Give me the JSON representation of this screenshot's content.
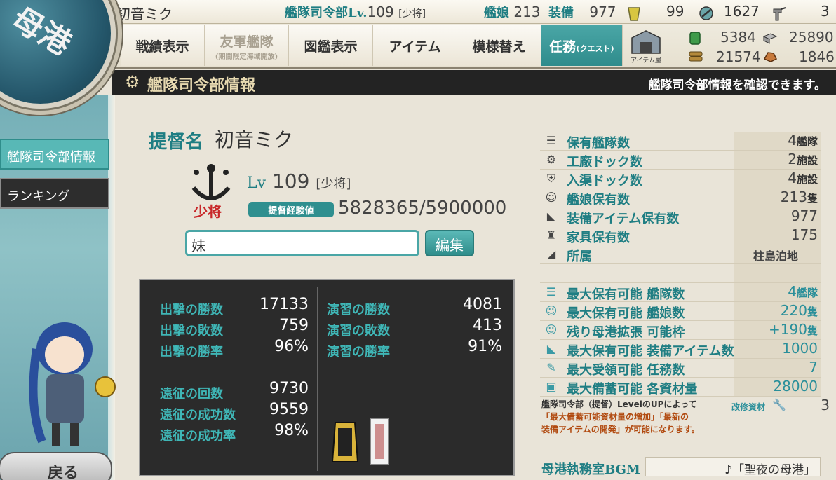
{
  "port": {
    "emblem_text": "母港"
  },
  "status": {
    "player_name": "初音ミク",
    "hq_label": "艦隊司令部Lv.",
    "hq_level": "109",
    "rank": "[少将]",
    "ships_label": "艦娘",
    "ships": "213",
    "equip_label": "装備",
    "equip": "977",
    "bucket": "99",
    "devmat": "1627",
    "screw": "3"
  },
  "menu": {
    "record": "戦績表示",
    "friend_fleet": "友軍艦隊",
    "friend_fleet_sub": "(期間限定海域開放)",
    "album": "図鑑表示",
    "item": "アイテム",
    "remodel": "模様替え",
    "quest": "任務",
    "quest_sub": "(クエスト)",
    "shop": "アイテム屋"
  },
  "resources": {
    "fuel": "5384",
    "ammo": "21574",
    "steel": "25890",
    "bauxite": "1846"
  },
  "header": {
    "title": "艦隊司令部情報",
    "desc": "艦隊司令部情報を確認できます。"
  },
  "sidebar": {
    "hq_info": "艦隊司令部情報",
    "ranking": "ランキング",
    "back": "戻る"
  },
  "profile": {
    "admiral_label": "提督名",
    "admiral_name": "初音ミク",
    "rank_badge": "少将",
    "lv_label": "Lv",
    "lv": "109",
    "rank": "[少将]",
    "exp_label": "提督経験値",
    "exp": "5828365/5900000",
    "comment": "妹",
    "edit": "編集"
  },
  "stats": {
    "sortie_wins_label": "出撃の勝数",
    "sortie_wins": "17133",
    "sortie_losses_label": "出撃の敗数",
    "sortie_losses": "759",
    "sortie_rate_label": "出撃の勝率",
    "sortie_rate": "96%",
    "pvp_wins_label": "演習の勝数",
    "pvp_wins": "4081",
    "pvp_losses_label": "演習の敗数",
    "pvp_losses": "413",
    "pvp_rate_label": "演習の勝率",
    "pvp_rate": "91%",
    "exp_count_label": "遠征の回数",
    "exp_count": "9730",
    "exp_success_label": "遠征の成功数",
    "exp_success": "9559",
    "exp_rate_label": "遠征の成功率",
    "exp_rate": "98%"
  },
  "info": {
    "fleets_label": "保有艦隊数",
    "fleets": "4",
    "fleets_unit": "艦隊",
    "arsenal_label": "工廠ドック数",
    "arsenal": "2",
    "arsenal_unit": "施設",
    "repair_label": "入渠ドック数",
    "repair": "4",
    "repair_unit": "施設",
    "ships_label": "艦娘保有数",
    "ships": "213",
    "ships_unit": "隻",
    "equip_label": "装備アイテム保有数",
    "equip": "977",
    "furniture_label": "家具保有数",
    "furniture": "175",
    "affiliation_label": "所属",
    "affiliation": "柱島泊地",
    "max_fleets_label": "最大保有可能 艦隊数",
    "max_fleets": "4",
    "max_fleets_unit": "艦隊",
    "max_ships_label": "最大保有可能 艦娘数",
    "max_ships": "220",
    "max_ships_unit": "隻",
    "expand_label": "残り母港拡張 可能枠",
    "expand": "+190",
    "expand_unit": "隻",
    "max_equip_label": "最大保有可能 装備アイテム数",
    "max_equip": "1000",
    "max_quest_label": "最大受領可能 任務数",
    "max_quest": "7",
    "max_resource_label": "最大備蓄可能 各資材量",
    "max_resource": "28000"
  },
  "note": {
    "line1": "艦隊司令部（提督）LevelのUPによって",
    "line2": "「最大備蓄可能資材量の増加」「最新の",
    "line3": "装備アイテムの開発」が可能になります。",
    "upgrade_label": "改修資材",
    "upgrade": "3"
  },
  "bgm": {
    "label": "母港執務室BGM",
    "track": "♪「聖夜の母港」"
  }
}
